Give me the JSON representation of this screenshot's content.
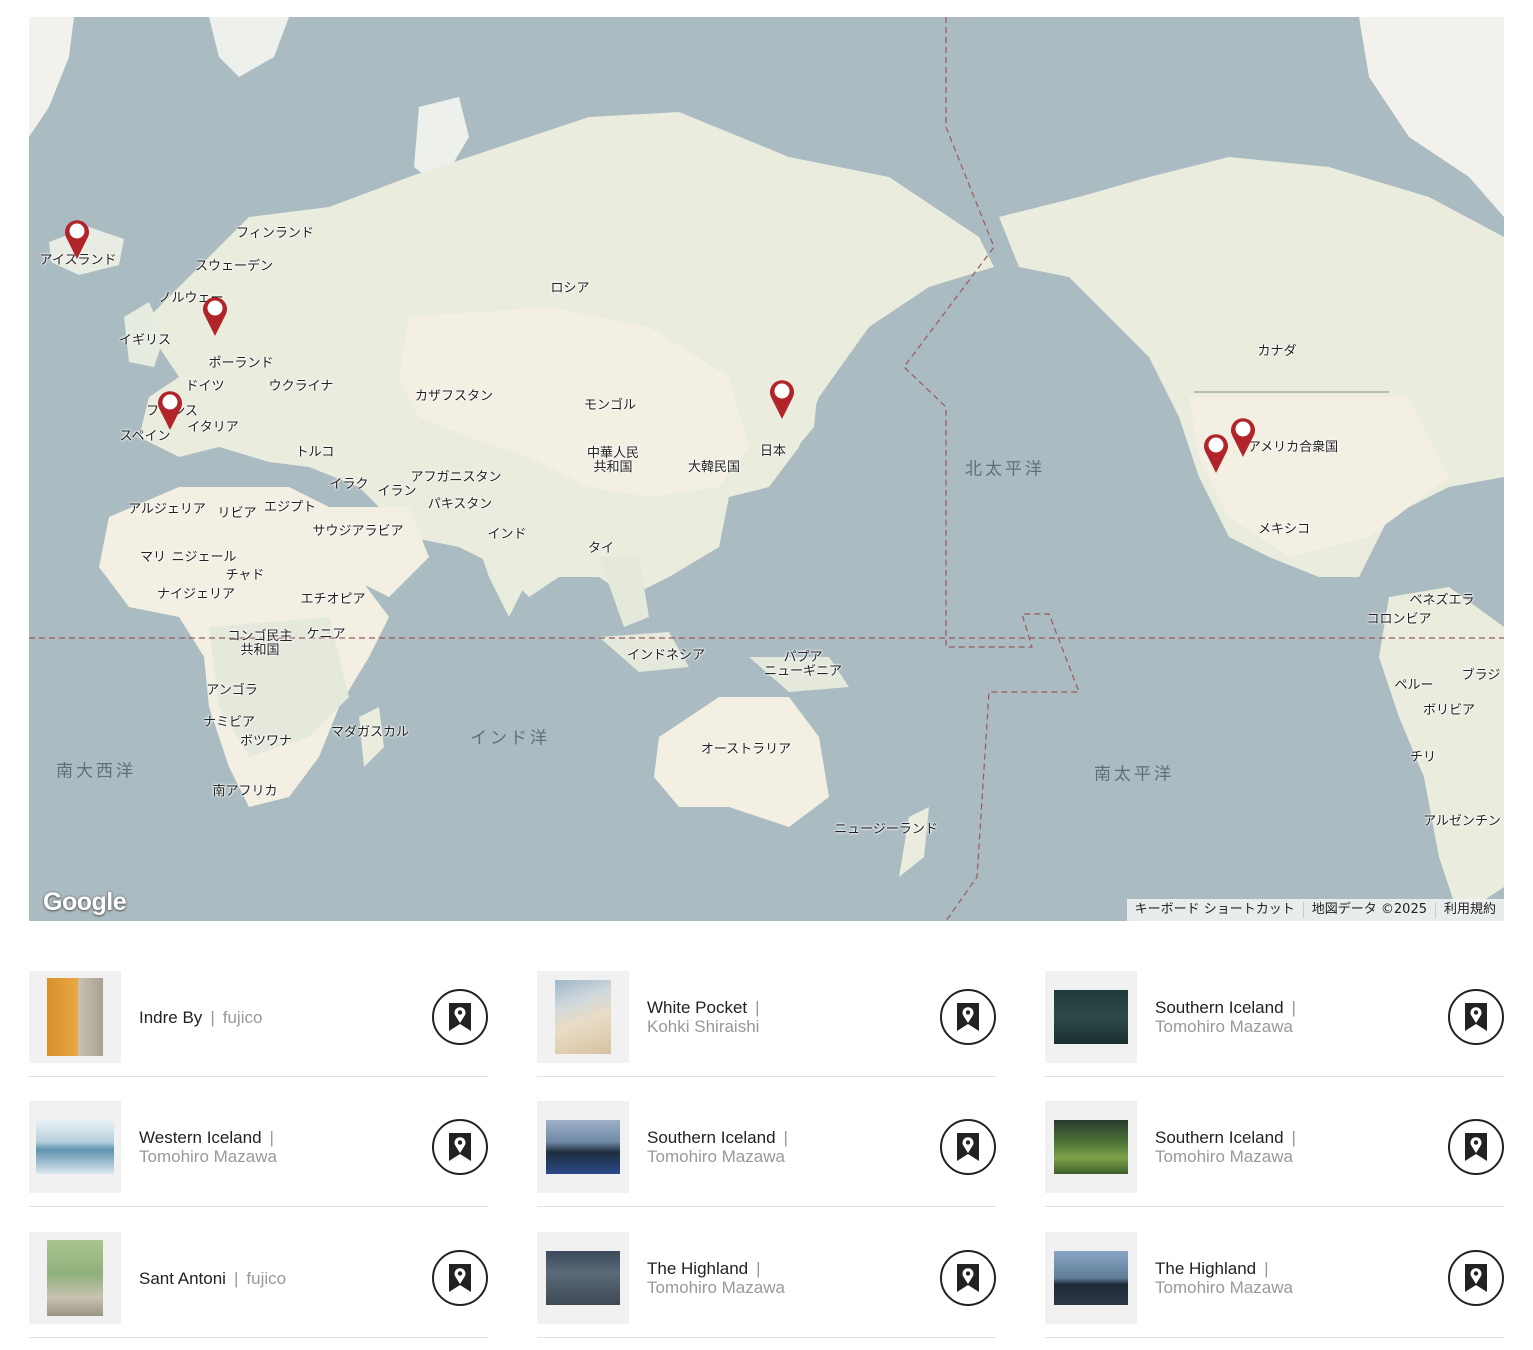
{
  "map": {
    "countries": [
      {
        "id": "iceland",
        "label": "アイスランド"
      },
      {
        "id": "finland",
        "label": "フィンランド"
      },
      {
        "id": "sweden",
        "label": "スウェーデン"
      },
      {
        "id": "norway",
        "label": "ノルウェー"
      },
      {
        "id": "uk",
        "label": "イギリス"
      },
      {
        "id": "poland",
        "label": "ポーランド"
      },
      {
        "id": "germany",
        "label": "ドイツ"
      },
      {
        "id": "ukraine",
        "label": "ウクライナ"
      },
      {
        "id": "france",
        "label": "フランス"
      },
      {
        "id": "spain",
        "label": "スペイン"
      },
      {
        "id": "italy",
        "label": "イタリア"
      },
      {
        "id": "turkey",
        "label": "トルコ"
      },
      {
        "id": "russia",
        "label": "ロシア"
      },
      {
        "id": "kazakhstan",
        "label": "カザフスタン"
      },
      {
        "id": "mongolia",
        "label": "モンゴル"
      },
      {
        "id": "china",
        "label": "中華人民\n共和国"
      },
      {
        "id": "korea",
        "label": "大韓民国"
      },
      {
        "id": "japan",
        "label": "日本"
      },
      {
        "id": "afghanistan",
        "label": "アフガニスタン"
      },
      {
        "id": "iraq",
        "label": "イラク"
      },
      {
        "id": "iran",
        "label": "イラン"
      },
      {
        "id": "pakistan",
        "label": "パキスタン"
      },
      {
        "id": "india",
        "label": "インド"
      },
      {
        "id": "thailand",
        "label": "タイ"
      },
      {
        "id": "saudi",
        "label": "サウジアラビア"
      },
      {
        "id": "algeria",
        "label": "アルジェリア"
      },
      {
        "id": "libya",
        "label": "リビア"
      },
      {
        "id": "egypt",
        "label": "エジプト"
      },
      {
        "id": "mali",
        "label": "マリ"
      },
      {
        "id": "niger",
        "label": "ニジェール"
      },
      {
        "id": "chad",
        "label": "チャド"
      },
      {
        "id": "nigeria",
        "label": "ナイジェリア"
      },
      {
        "id": "ethiopia",
        "label": "エチオピア"
      },
      {
        "id": "drc",
        "label": "コンゴ民主\n共和国"
      },
      {
        "id": "kenya",
        "label": "ケニア"
      },
      {
        "id": "angola",
        "label": "アンゴラ"
      },
      {
        "id": "namibia",
        "label": "ナミビア"
      },
      {
        "id": "botswana",
        "label": "ボツワナ"
      },
      {
        "id": "madagascar",
        "label": "マダガスカル"
      },
      {
        "id": "southafrica",
        "label": "南アフリカ"
      },
      {
        "id": "indonesia",
        "label": "インドネシア"
      },
      {
        "id": "png",
        "label": "パプア\nニューギニア"
      },
      {
        "id": "australia",
        "label": "オーストラリア"
      },
      {
        "id": "newzealand",
        "label": "ニュージーランド"
      },
      {
        "id": "canada",
        "label": "カナダ"
      },
      {
        "id": "usa",
        "label": "アメリカ合衆国"
      },
      {
        "id": "mexico",
        "label": "メキシコ"
      },
      {
        "id": "venezuela",
        "label": "ベネズエラ"
      },
      {
        "id": "colombia",
        "label": "コロンビア"
      },
      {
        "id": "peru",
        "label": "ペルー"
      },
      {
        "id": "brazil",
        "label": "ブラジ"
      },
      {
        "id": "bolivia",
        "label": "ボリビア"
      },
      {
        "id": "chile",
        "label": "チリ"
      },
      {
        "id": "argentina",
        "label": "アルゼンチン"
      }
    ],
    "oceans": [
      {
        "id": "north-pacific",
        "label": "北太平洋"
      },
      {
        "id": "south-pacific",
        "label": "南太平洋"
      },
      {
        "id": "indian",
        "label": "インド洋"
      },
      {
        "id": "south-atlantic",
        "label": "南大西洋"
      }
    ],
    "markers": [
      {
        "id": "iceland"
      },
      {
        "id": "denmark"
      },
      {
        "id": "spain"
      },
      {
        "id": "japan"
      },
      {
        "id": "usa-1"
      },
      {
        "id": "usa-2"
      }
    ],
    "logo": "Google",
    "attribution": {
      "shortcuts": "キーボード ショートカット",
      "data": "地図データ ©2025",
      "terms": "利用規約"
    },
    "colors": {
      "water": "#aabbc1",
      "land": "#f4f1e8",
      "marker": "#b0242a"
    }
  },
  "cards": [
    {
      "title": "Indre By",
      "sep": "|",
      "author": "fujico",
      "thumb_icon": "yellow-building-photo"
    },
    {
      "title": "White Pocket",
      "sep": "|",
      "author": "Kohki Shiraishi",
      "thumb_icon": "sand-dune-photo"
    },
    {
      "title": "Southern Iceland",
      "sep": "|",
      "author": "Tomohiro Mazawa",
      "thumb_icon": "dark-grass-photo"
    },
    {
      "title": "Western Iceland",
      "sep": "|",
      "author": "Tomohiro Mazawa",
      "thumb_icon": "blue-lagoon-photo"
    },
    {
      "title": "Southern Iceland",
      "sep": "|",
      "author": "Tomohiro Mazawa",
      "thumb_icon": "blue-road-photo"
    },
    {
      "title": "Southern Iceland",
      "sep": "|",
      "author": "Tomohiro Mazawa",
      "thumb_icon": "green-hills-photo"
    },
    {
      "title": "Sant Antoni",
      "sep": "|",
      "author": "fujico",
      "thumb_icon": "tree-street-photo"
    },
    {
      "title": "The Highland",
      "sep": "|",
      "author": "Tomohiro Mazawa",
      "thumb_icon": "rocky-hill-photo"
    },
    {
      "title": "The Highland",
      "sep": "|",
      "author": "Tomohiro Mazawa",
      "thumb_icon": "coastal-cliff-photo"
    }
  ]
}
